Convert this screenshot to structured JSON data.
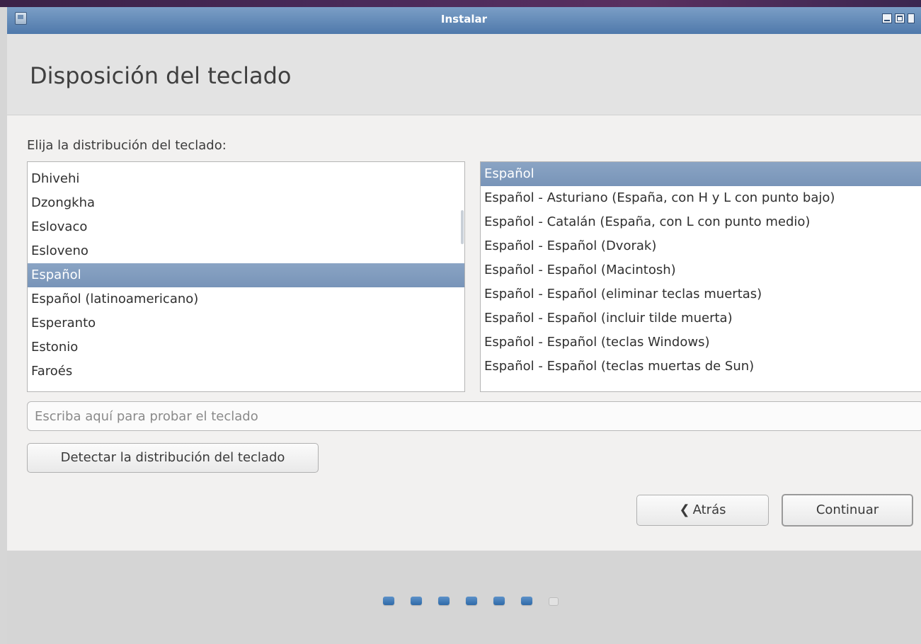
{
  "window": {
    "title": "Instalar"
  },
  "header": {
    "title": "Disposición del teclado"
  },
  "prompt": "Elija la distribución del teclado:",
  "layouts": [
    "Dhivehi",
    "Dzongkha",
    "Eslovaco",
    "Esloveno",
    "Español",
    "Español (latinoamericano)",
    "Esperanto",
    "Estonio",
    "Faroés"
  ],
  "layouts_selected": "Español",
  "variants": [
    "Español",
    "Español - Asturiano (España, con H y L con punto bajo)",
    "Español - Catalán (España, con L con punto medio)",
    "Español - Español (Dvorak)",
    "Español - Español (Macintosh)",
    "Español - Español (eliminar teclas muertas)",
    "Español - Español (incluir tilde muerta)",
    "Español - Español (teclas Windows)",
    "Español - Español (teclas muertas de Sun)"
  ],
  "variants_selected": "Español",
  "test_input": {
    "placeholder": "Escriba aquí para probar el teclado",
    "value": ""
  },
  "buttons": {
    "detect": "Detectar la distribución del teclado",
    "back": "Atrás",
    "continue": "Continuar"
  },
  "progress": {
    "total_steps": 7,
    "completed_steps": 6
  },
  "colors": {
    "accent": "#3e72ad",
    "selection": "#8aa4c4"
  }
}
